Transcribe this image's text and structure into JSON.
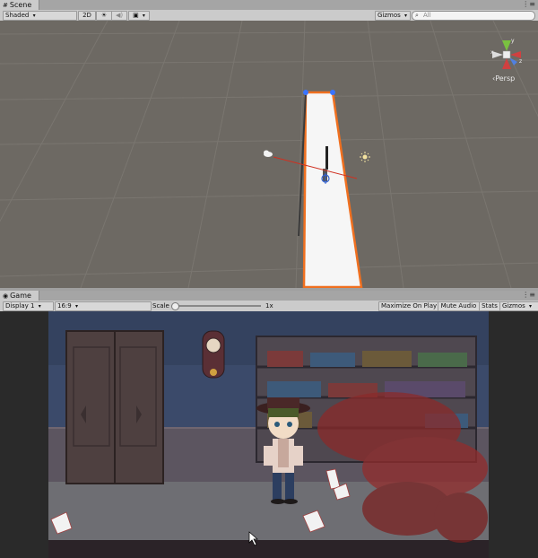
{
  "scene_panel": {
    "tab_label": "Scene",
    "shading_mode": "Shaded",
    "mode_2d": "2D",
    "gizmos_label": "Gizmos",
    "search_placeholder": "All",
    "persp_label": "Persp"
  },
  "game_panel": {
    "tab_label": "Game",
    "display": "Display 1",
    "aspect": "16:9",
    "scale_label": "Scale",
    "scale_value": "1x",
    "maximize_on_play": "Maximize On Play",
    "mute_audio": "Mute Audio",
    "stats": "Stats",
    "gizmos_label": "Gizmos"
  },
  "colors": {
    "scene_bg": "#6d6963",
    "selection_outline": "#f07020",
    "game_bg": "#2a2a2a"
  }
}
